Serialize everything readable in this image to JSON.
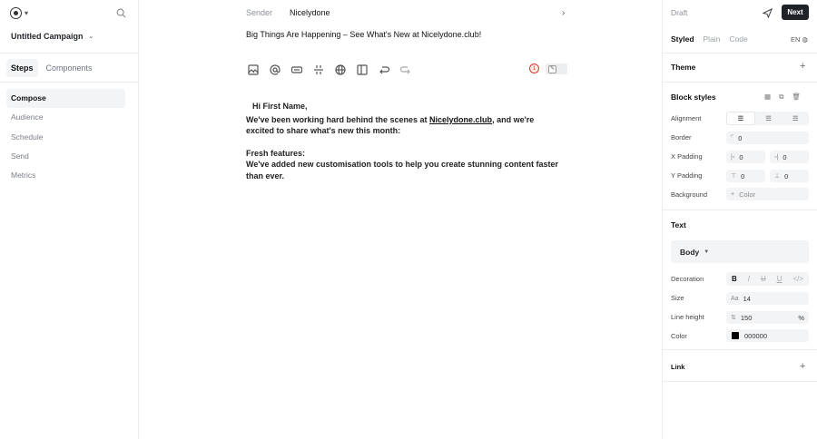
{
  "sidebar": {
    "campaign_title": "Untitled Campaign",
    "tabs": [
      {
        "label": "Steps",
        "active": true
      },
      {
        "label": "Components",
        "active": false
      }
    ],
    "steps": [
      {
        "label": "Compose",
        "active": true
      },
      {
        "label": "Audience",
        "active": false
      },
      {
        "label": "Schedule",
        "active": false
      },
      {
        "label": "Send",
        "active": false
      },
      {
        "label": "Metrics",
        "active": false
      }
    ]
  },
  "editor": {
    "sender_label": "Sender",
    "sender_value": "Nicelydone",
    "subject": "Big Things Are Happening – See What's New at Nicelydone.club!",
    "error_count": "1",
    "greeting": "Hi First Name,",
    "para1_a": "We've been working hard behind the scenes at ",
    "para1_link": "Nicelydone.club",
    "para1_b": ", and we're excited to share what's new this month:",
    "heading": "Fresh features:",
    "para2": "We've added new customisation tools to help you create stunning content faster than ever."
  },
  "panel": {
    "status": "Draft",
    "next_label": "Next",
    "view_tabs": [
      {
        "label": "Styled",
        "active": true
      },
      {
        "label": "Plain",
        "active": false
      },
      {
        "label": "Code",
        "active": false
      }
    ],
    "language": "EN",
    "theme_label": "Theme",
    "block_styles_label": "Block styles",
    "alignment_label": "Alignment",
    "border_label": "Border",
    "border_value": "0",
    "x_padding_label": "X Padding",
    "x_padding_left": "0",
    "x_padding_right": "0",
    "y_padding_label": "Y Padding",
    "y_padding_top": "0",
    "y_padding_bottom": "0",
    "background_label": "Background",
    "background_placeholder": "Color",
    "text_label": "Text",
    "text_style": "Body",
    "decoration_label": "Decoration",
    "size_label": "Size",
    "size_value": "14",
    "line_height_label": "Line height",
    "line_height_value": "150",
    "line_height_unit": "%",
    "color_label": "Color",
    "color_value": "000000",
    "link_label": "Link"
  }
}
